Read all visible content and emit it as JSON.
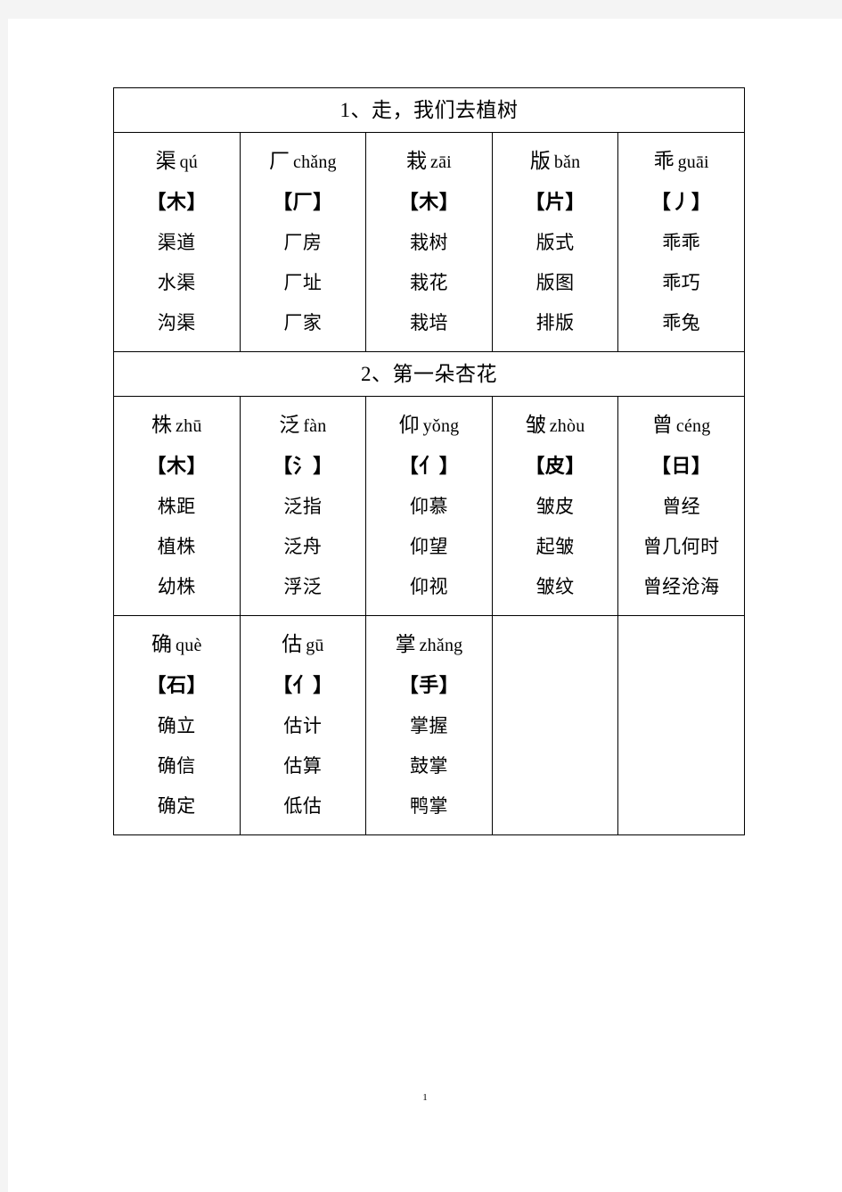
{
  "document": {
    "page_number": "1"
  },
  "table": {
    "sections": [
      {
        "title": "1、走，我们去植树",
        "rows": [
          {
            "cells": [
              {
                "character": "渠",
                "pinyin": "qú",
                "radical": "【木】",
                "words": [
                  "渠道",
                  "水渠",
                  "沟渠"
                ]
              },
              {
                "character": "厂",
                "pinyin": "chǎng",
                "radical": "【厂】",
                "words": [
                  "厂房",
                  "厂址",
                  "厂家"
                ]
              },
              {
                "character": "栽",
                "pinyin": "zāi",
                "radical": "【木】",
                "words": [
                  "栽树",
                  "栽花",
                  "栽培"
                ]
              },
              {
                "character": "版",
                "pinyin": "bǎn",
                "radical": "【片】",
                "words": [
                  "版式",
                  "版图",
                  "排版"
                ]
              },
              {
                "character": "乖",
                "pinyin": "guāi",
                "radical": "【丿】",
                "words": [
                  "乖乖",
                  "乖巧",
                  "乖兔"
                ]
              }
            ]
          }
        ]
      },
      {
        "title": "2、第一朵杏花",
        "rows": [
          {
            "cells": [
              {
                "character": "株",
                "pinyin": "zhū",
                "radical": "【木】",
                "words": [
                  "株距",
                  "植株",
                  "幼株"
                ]
              },
              {
                "character": "泛",
                "pinyin": "fàn",
                "radical": "【氵】",
                "words": [
                  "泛指",
                  "泛舟",
                  "浮泛"
                ]
              },
              {
                "character": "仰",
                "pinyin": "yǒng",
                "radical": "【亻】",
                "words": [
                  "仰慕",
                  "仰望",
                  "仰视"
                ]
              },
              {
                "character": "皱",
                "pinyin": "zhòu",
                "radical": "【皮】",
                "words": [
                  "皱皮",
                  "起皱",
                  "皱纹"
                ]
              },
              {
                "character": "曾",
                "pinyin": "céng",
                "radical": "【日】",
                "words": [
                  "曾经",
                  "曾几何时",
                  "曾经沧海"
                ]
              }
            ]
          },
          {
            "cells": [
              {
                "character": "确",
                "pinyin": "què",
                "radical": "【石】",
                "words": [
                  "确立",
                  "确信",
                  "确定"
                ]
              },
              {
                "character": "估",
                "pinyin": "gū",
                "radical": "【亻】",
                "words": [
                  "估计",
                  "估算",
                  "低估"
                ]
              },
              {
                "character": "掌",
                "pinyin": "zhǎng",
                "radical": "【手】",
                "words": [
                  "掌握",
                  "鼓掌",
                  "鸭掌"
                ]
              },
              {
                "empty": true
              },
              {
                "empty": true
              }
            ]
          }
        ]
      }
    ]
  }
}
